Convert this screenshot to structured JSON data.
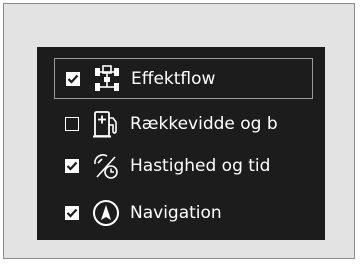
{
  "menu": {
    "items": [
      {
        "label": "Effektflow",
        "checked": true,
        "selected": true,
        "icon": "car-powertrain-icon"
      },
      {
        "label": "Rækkevidde og b",
        "checked": false,
        "selected": false,
        "icon": "fuel-pump-icon"
      },
      {
        "label": "Hastighed og tid",
        "checked": true,
        "selected": false,
        "icon": "speed-time-icon"
      },
      {
        "label": "Navigation",
        "checked": true,
        "selected": false,
        "icon": "navigation-icon"
      }
    ]
  },
  "colors": {
    "screen_background": "#1c1c1c",
    "frame_background": "#e3e3e3",
    "text": "#ffffff"
  }
}
